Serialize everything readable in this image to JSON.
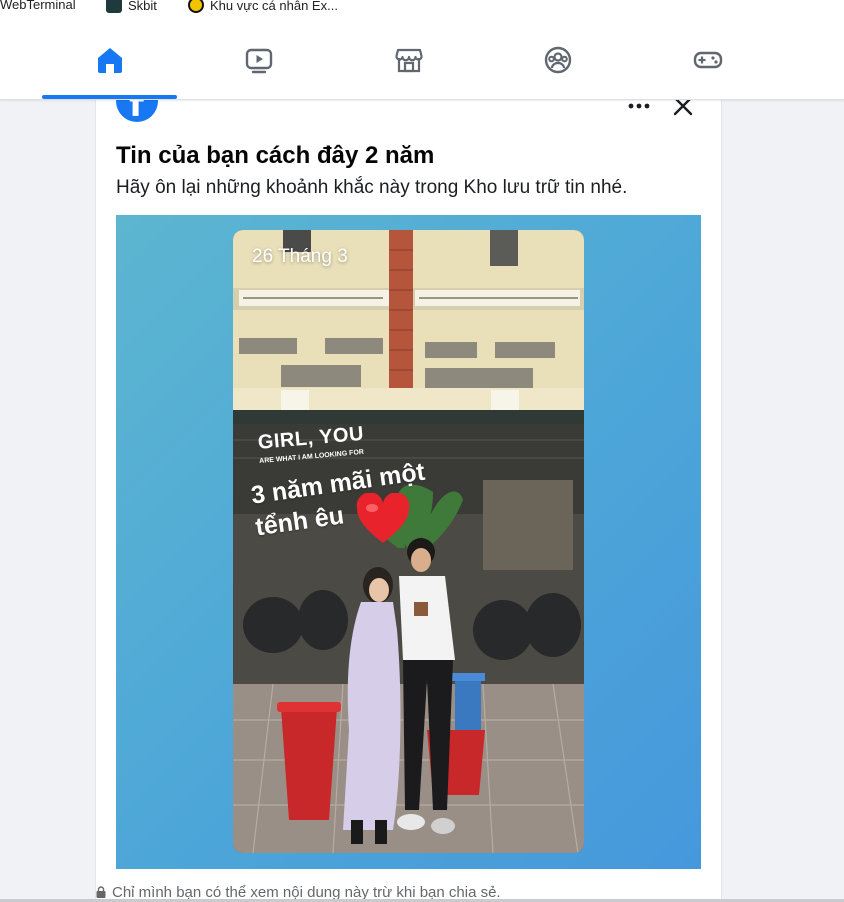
{
  "bookmarks": [
    {
      "label": "WebTerminal",
      "icon": "webterminal-icon"
    },
    {
      "label": "Skbit",
      "icon": "skbit-icon"
    },
    {
      "label": "Khu vực cá nhân Ex...",
      "icon": "exness-icon"
    }
  ],
  "nav": {
    "tabs": [
      {
        "name": "home",
        "icon": "home-icon",
        "active": true
      },
      {
        "name": "watch",
        "icon": "video-icon"
      },
      {
        "name": "marketplace",
        "icon": "marketplace-icon"
      },
      {
        "name": "groups",
        "icon": "groups-icon"
      },
      {
        "name": "gaming",
        "icon": "gamepad-icon"
      }
    ],
    "accent": "#1877f2"
  },
  "memory": {
    "title": "Tin của bạn cách đây 2 năm",
    "subtitle": "Hãy ôn lại những khoảnh khắc này trong Kho lưu trữ tin nhé.",
    "story": {
      "date": "26 Tháng 3",
      "caption_line1": "GIRL, YOU",
      "caption_small": "ARE WHAT I AM LOOKING FOR",
      "caption_main_1": "3 năm mãi một",
      "caption_main_2": "tểnh êu"
    },
    "privacy_note": "Chỉ mình bạn có thể xem nội dung này trừ khi bạn chia sẻ."
  }
}
